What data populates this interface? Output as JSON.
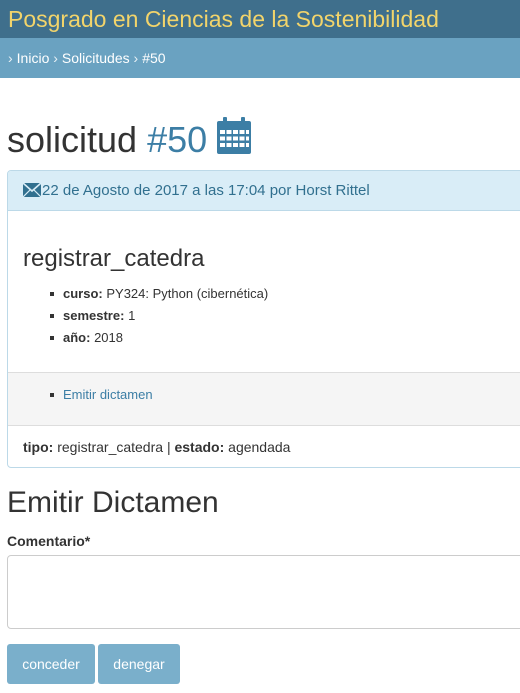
{
  "header": {
    "brand": "Posgrado en Ciencias de la Sostenibilidad"
  },
  "breadcrumb": {
    "separator": "›",
    "items": [
      "Inicio",
      "Solicitudes",
      "#50"
    ]
  },
  "page": {
    "title_prefix": "solicitud",
    "title_number": "#50",
    "title_icon": "calendar-icon"
  },
  "panel": {
    "header_icon": "envelope-icon",
    "header_text": "22 de Agosto de 2017 a las 17:04 por Horst Rittel",
    "request_type_title": "registrar_catedra",
    "details": [
      {
        "label": "curso:",
        "value": "PY324: Python (cibernética)"
      },
      {
        "label": "semestre:",
        "value": "1"
      },
      {
        "label": "año:",
        "value": "2018"
      }
    ],
    "actions": [
      "Emitir dictamen"
    ],
    "footer": {
      "tipo_label": "tipo:",
      "tipo_value": "registrar_catedra",
      "divider": "|",
      "estado_label": "estado:",
      "estado_value": "agendada"
    }
  },
  "form": {
    "section_title": "Emitir Dictamen",
    "comment_label": "Comentario*",
    "comment_value": "",
    "buttons": {
      "accept": "conceder",
      "deny": "denegar"
    }
  },
  "colors": {
    "topbar": "#3f6f8c",
    "brand": "#f2d46b",
    "breadcrumb_bar": "#6aa2c1",
    "link": "#3c7ea5",
    "panel_header_bg": "#d9edf7",
    "button_bg": "#7aafcb"
  }
}
